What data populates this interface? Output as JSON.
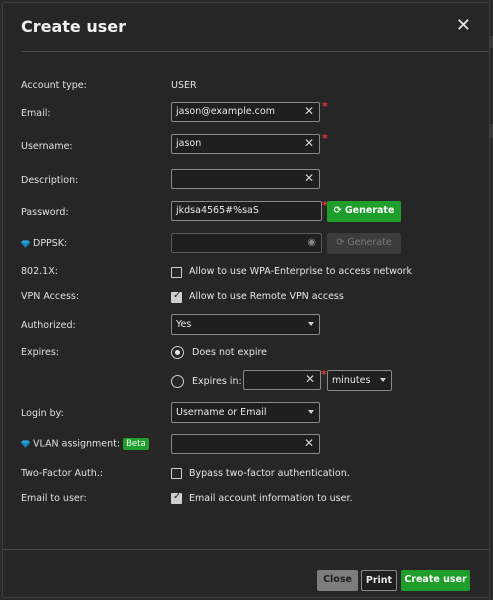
{
  "dialog": {
    "title": "Create user"
  },
  "fields": {
    "account_type": {
      "label": "Account type:",
      "value": "USER"
    },
    "email": {
      "label": "Email:",
      "value": "jason@example.com"
    },
    "username": {
      "label": "Username:",
      "value": "jason"
    },
    "description": {
      "label": "Description:",
      "value": ""
    },
    "password": {
      "label": "Password:",
      "value": "jkdsa4565#%saS",
      "generate_label": "Generate"
    },
    "dppsk": {
      "label": "DPPSK:",
      "value": "",
      "generate_label": "Generate"
    },
    "dot1x": {
      "label": "802.1X:",
      "checkbox_label": "Allow to use WPA-Enterprise to access network",
      "checked": false
    },
    "vpn": {
      "label": "VPN Access:",
      "checkbox_label": "Allow to use Remote VPN access",
      "checked": true
    },
    "authorized": {
      "label": "Authorized:",
      "value": "Yes"
    },
    "expires": {
      "label": "Expires:",
      "option_never": "Does not expire",
      "option_in": "Expires in:",
      "selected": "never",
      "amount": "",
      "unit": "minutes"
    },
    "login_by": {
      "label": "Login by:",
      "value": "Username or Email"
    },
    "vlan": {
      "label": "VLAN assignment:",
      "badge": "Beta",
      "value": ""
    },
    "two_factor": {
      "label": "Two-Factor Auth.:",
      "checkbox_label": "Bypass two-factor authentication.",
      "checked": false
    },
    "email_to_user": {
      "label": "Email to user:",
      "checkbox_label": "Email account information to user.",
      "checked": true
    }
  },
  "footer": {
    "close_label": "Close",
    "print_label": "Print",
    "create_label": "Create user"
  },
  "icons": {
    "close": "close-icon",
    "clear": "clear-icon",
    "eye": "eye-icon",
    "diamond": "diamond-icon",
    "refresh": "refresh-icon"
  },
  "colors": {
    "accent_green": "#1f9e2c",
    "required_red": "#e53935",
    "diamond_blue": "#29a8e0"
  }
}
